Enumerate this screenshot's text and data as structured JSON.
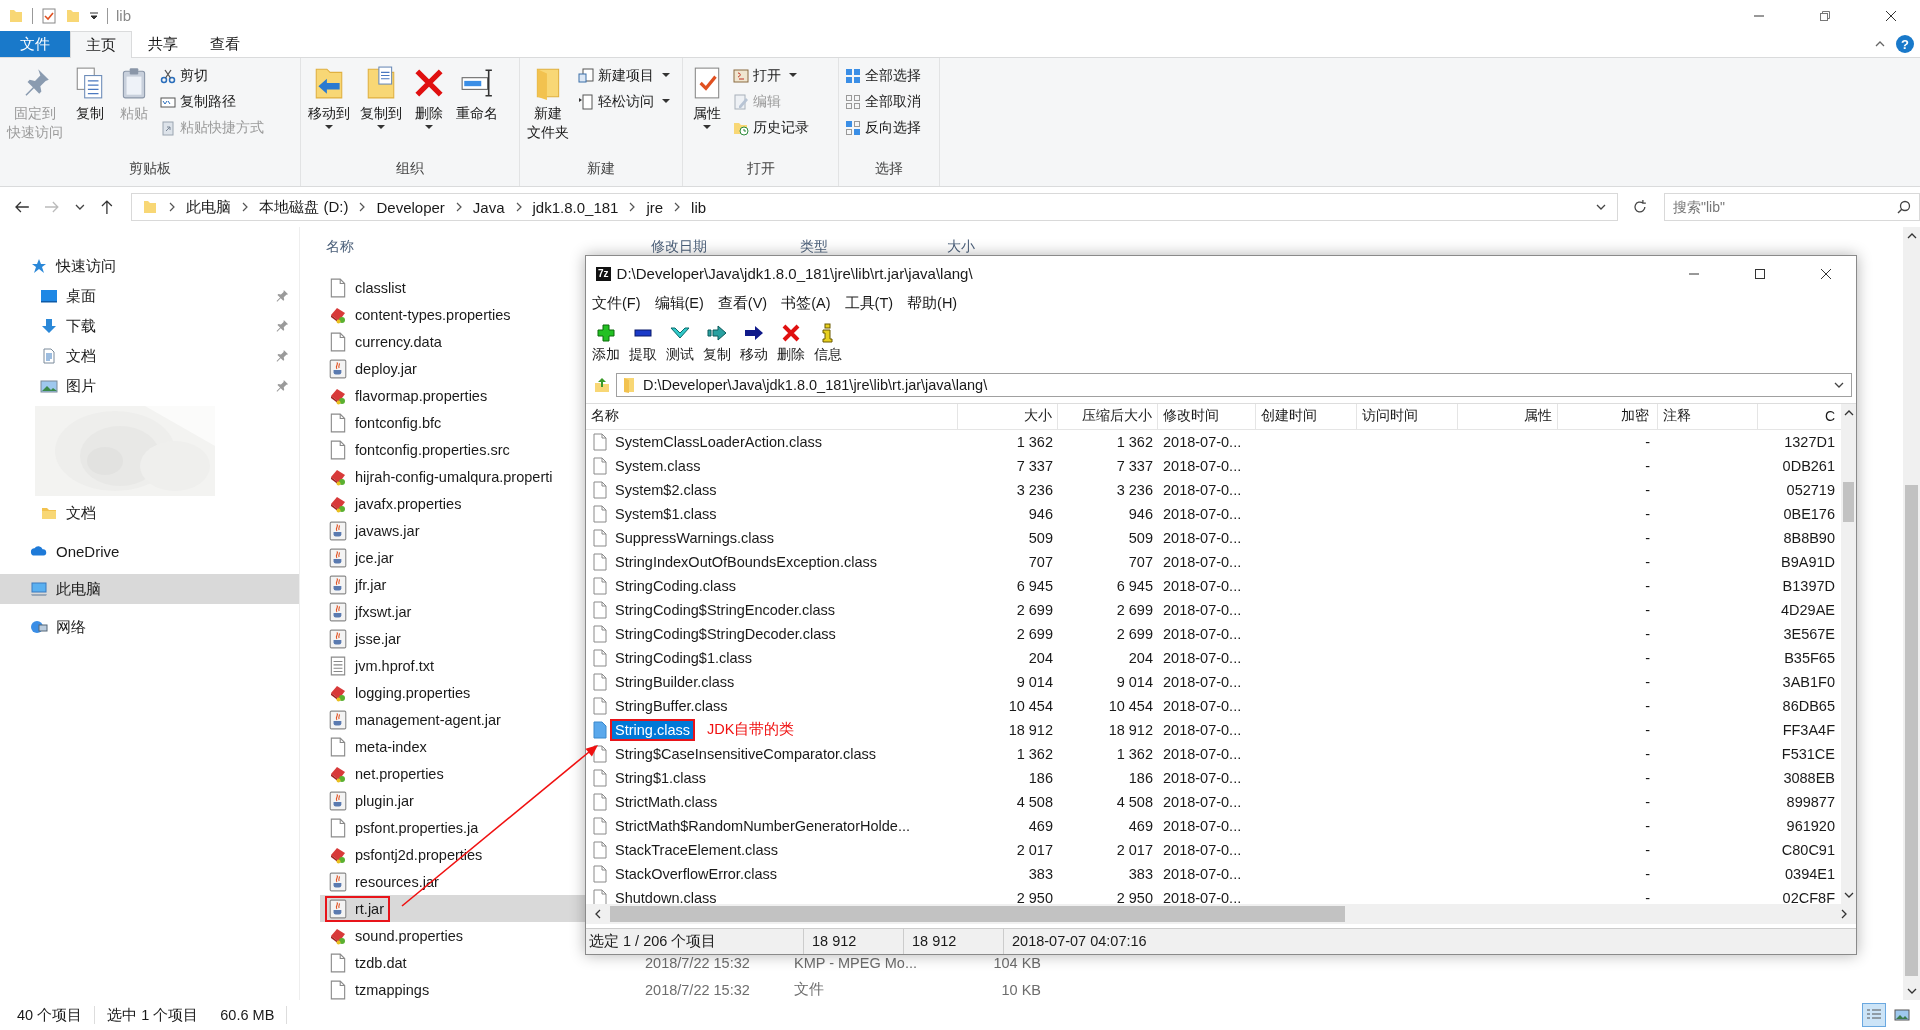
{
  "explorer": {
    "title": "lib",
    "tabs": [
      {
        "label": "文件",
        "kind": "file",
        "selected": false
      },
      {
        "label": "主页",
        "kind": "tab",
        "selected": true
      },
      {
        "label": "共享",
        "kind": "tab",
        "selected": false
      },
      {
        "label": "查看",
        "kind": "tab",
        "selected": false
      }
    ],
    "help": "?",
    "ribbon": [
      {
        "label": "剪贴板",
        "items": [
          {
            "lines": [
              "固定到",
              "快速访问"
            ],
            "kind": "large",
            "disabled": true,
            "dropdown": false
          },
          {
            "lines": [
              "复制"
            ],
            "kind": "large",
            "disabled": false,
            "dropdown": false
          },
          {
            "lines": [
              "粘贴"
            ],
            "kind": "large",
            "disabled": true,
            "dropdown": false
          },
          {
            "label": "剪切",
            "kind": "small",
            "disabled": false,
            "dropdown": false
          },
          {
            "label": "复制路径",
            "kind": "small",
            "disabled": false,
            "dropdown": false
          },
          {
            "label": "粘贴快捷方式",
            "kind": "small",
            "disabled": true,
            "dropdown": false
          }
        ]
      },
      {
        "label": "组织",
        "items": [
          {
            "lines": [
              "移动到"
            ],
            "kind": "large",
            "disabled": false,
            "dropdown": true
          },
          {
            "lines": [
              "复制到"
            ],
            "kind": "large",
            "disabled": false,
            "dropdown": true
          },
          {
            "lines": [
              "删除"
            ],
            "kind": "large",
            "disabled": false,
            "dropdown": true
          },
          {
            "lines": [
              "重命名"
            ],
            "kind": "large",
            "disabled": false,
            "dropdown": false
          }
        ]
      },
      {
        "label": "新建",
        "items": [
          {
            "lines": [
              "新建",
              "文件夹"
            ],
            "kind": "large",
            "disabled": false,
            "dropdown": false
          },
          {
            "label": "新建项目",
            "kind": "small",
            "disabled": false,
            "dropdown": true
          },
          {
            "label": "轻松访问",
            "kind": "small",
            "disabled": false,
            "dropdown": true
          }
        ]
      },
      {
        "label": "打开",
        "items": [
          {
            "lines": [
              "属性"
            ],
            "kind": "large",
            "disabled": false,
            "dropdown": true
          },
          {
            "label": "打开",
            "kind": "small",
            "disabled": false,
            "dropdown": true
          },
          {
            "label": "编辑",
            "kind": "small",
            "disabled": true,
            "dropdown": false
          },
          {
            "label": "历史记录",
            "kind": "small",
            "disabled": false,
            "dropdown": false
          }
        ]
      },
      {
        "label": "选择",
        "items": [
          {
            "label": "全部选择",
            "kind": "small",
            "disabled": false,
            "dropdown": false
          },
          {
            "label": "全部取消",
            "kind": "small",
            "disabled": false,
            "dropdown": false
          },
          {
            "label": "反向选择",
            "kind": "small",
            "disabled": false,
            "dropdown": false
          }
        ]
      }
    ],
    "breadcrumb": [
      "此电脑",
      "本地磁盘 (D:)",
      "Developer",
      "Java",
      "jdk1.8.0_181",
      "jre",
      "lib"
    ],
    "search": {
      "placeholder": "搜索\"lib\""
    },
    "nav": [
      {
        "label": "快速访问",
        "kind": "quick",
        "selected": false,
        "pinned": false,
        "children": [
          {
            "label": "桌面",
            "kind": "desktop",
            "selected": false,
            "pinned": true
          },
          {
            "label": "下载",
            "kind": "download",
            "selected": false,
            "pinned": true
          },
          {
            "label": "文档",
            "kind": "docs",
            "selected": false,
            "pinned": true
          },
          {
            "label": "图片",
            "kind": "pictures",
            "selected": false,
            "pinned": true
          },
          {
            "kind": "picture"
          },
          {
            "label": "文档",
            "kind": "folder",
            "selected": false,
            "pinned": false
          }
        ]
      },
      {
        "label": "OneDrive",
        "kind": "onedrive",
        "selected": false,
        "pinned": false
      },
      {
        "label": "此电脑",
        "kind": "pc",
        "selected": true,
        "pinned": false
      },
      {
        "label": "网络",
        "kind": "network",
        "selected": false,
        "pinned": false
      }
    ],
    "columns": [
      "名称",
      "修改日期",
      "类型",
      "大小"
    ],
    "files": [
      {
        "name": "classlist",
        "kind": "blank",
        "selected": false,
        "annotated": false
      },
      {
        "name": "content-types.properties",
        "kind": "props",
        "selected": false,
        "annotated": false
      },
      {
        "name": "currency.data",
        "kind": "blank",
        "selected": false,
        "annotated": false
      },
      {
        "name": "deploy.jar",
        "kind": "jar",
        "selected": false,
        "annotated": false
      },
      {
        "name": "flavormap.properties",
        "kind": "props",
        "selected": false,
        "annotated": false
      },
      {
        "name": "fontconfig.bfc",
        "kind": "blank",
        "selected": false,
        "annotated": false
      },
      {
        "name": "fontconfig.properties.src",
        "kind": "blank",
        "selected": false,
        "annotated": false
      },
      {
        "name": "hijrah-config-umalqura.properti",
        "kind": "props",
        "selected": false,
        "annotated": false
      },
      {
        "name": "javafx.properties",
        "kind": "props",
        "selected": false,
        "annotated": false
      },
      {
        "name": "javaws.jar",
        "kind": "jar",
        "selected": false,
        "annotated": false
      },
      {
        "name": "jce.jar",
        "kind": "jar",
        "selected": false,
        "annotated": false
      },
      {
        "name": "jfr.jar",
        "kind": "jar",
        "selected": false,
        "annotated": false
      },
      {
        "name": "jfxswt.jar",
        "kind": "jar",
        "selected": false,
        "annotated": false
      },
      {
        "name": "jsse.jar",
        "kind": "jar",
        "selected": false,
        "annotated": false
      },
      {
        "name": "jvm.hprof.txt",
        "kind": "text",
        "selected": false,
        "annotated": false
      },
      {
        "name": "logging.properties",
        "kind": "props",
        "selected": false,
        "annotated": false
      },
      {
        "name": "management-agent.jar",
        "kind": "jar",
        "selected": false,
        "annotated": false
      },
      {
        "name": "meta-index",
        "kind": "blank",
        "selected": false,
        "annotated": false
      },
      {
        "name": "net.properties",
        "kind": "props",
        "selected": false,
        "annotated": false
      },
      {
        "name": "plugin.jar",
        "kind": "jar",
        "selected": false,
        "annotated": false
      },
      {
        "name": "psfont.properties.ja",
        "kind": "blank",
        "selected": false,
        "annotated": false
      },
      {
        "name": "psfontj2d.properties",
        "kind": "props",
        "selected": false,
        "annotated": false
      },
      {
        "name": "resources.jar",
        "kind": "jar",
        "selected": false,
        "annotated": false
      },
      {
        "name": "rt.jar",
        "kind": "jar",
        "selected": true,
        "annotated": true
      },
      {
        "name": "sound.properties",
        "kind": "props",
        "selected": false,
        "annotated": false
      },
      {
        "name": "tzdb.dat",
        "kind": "blank",
        "selected": false,
        "annotated": false,
        "date": "2018/7/22 15:32",
        "type": "KMP - MPEG Mo...",
        "size": "104 KB"
      },
      {
        "name": "tzmappings",
        "kind": "blank",
        "selected": false,
        "annotated": false,
        "date": "2018/7/22 15:32",
        "type": "文件",
        "size": "10 KB"
      }
    ],
    "status": [
      "40 个项目",
      "选中 1 个项目",
      "60.6 MB"
    ],
    "views": [
      {
        "kind": "details",
        "selected": true
      },
      {
        "kind": "icons",
        "selected": false
      }
    ]
  },
  "archive_window": {
    "logo": "7z",
    "title": "D:\\Developer\\Java\\jdk1.8.0_181\\jre\\lib\\rt.jar\\java\\lang\\",
    "menu": [
      "文件(F)",
      "编辑(E)",
      "查看(V)",
      "书签(A)",
      "工具(T)",
      "帮助(H)"
    ],
    "toolbar": [
      {
        "label": "添加",
        "kind": "add"
      },
      {
        "label": "提取",
        "kind": "extract"
      },
      {
        "label": "测试",
        "kind": "test"
      },
      {
        "label": "复制",
        "kind": "copy"
      },
      {
        "label": "移动",
        "kind": "move"
      },
      {
        "label": "删除",
        "kind": "delete"
      },
      {
        "label": "信息",
        "kind": "info"
      }
    ],
    "path": "D:\\Developer\\Java\\jdk1.8.0_181\\jre\\lib\\rt.jar\\java\\lang\\",
    "columns": [
      "名称",
      "大小",
      "压缩后大小",
      "修改时间",
      "创建时间",
      "访问时间",
      "属性",
      "加密",
      "注释",
      "C"
    ],
    "rows": [
      {
        "name": "SystemClassLoaderAction.class",
        "size": "1 362",
        "packed": "1 362",
        "modified": "2018-07-0...",
        "encrypted": "-",
        "crc": "1327D1",
        "selected": false,
        "annotated": false
      },
      {
        "name": "System.class",
        "size": "7 337",
        "packed": "7 337",
        "modified": "2018-07-0...",
        "encrypted": "-",
        "crc": "0DB261",
        "selected": false,
        "annotated": false
      },
      {
        "name": "System$2.class",
        "size": "3 236",
        "packed": "3 236",
        "modified": "2018-07-0...",
        "encrypted": "-",
        "crc": "052719",
        "selected": false,
        "annotated": false
      },
      {
        "name": "System$1.class",
        "size": "946",
        "packed": "946",
        "modified": "2018-07-0...",
        "encrypted": "-",
        "crc": "0BE176",
        "selected": false,
        "annotated": false
      },
      {
        "name": "SuppressWarnings.class",
        "size": "509",
        "packed": "509",
        "modified": "2018-07-0...",
        "encrypted": "-",
        "crc": "8B8B90",
        "selected": false,
        "annotated": false
      },
      {
        "name": "StringIndexOutOfBoundsException.class",
        "size": "707",
        "packed": "707",
        "modified": "2018-07-0...",
        "encrypted": "-",
        "crc": "B9A91D",
        "selected": false,
        "annotated": false
      },
      {
        "name": "StringCoding.class",
        "size": "6 945",
        "packed": "6 945",
        "modified": "2018-07-0...",
        "encrypted": "-",
        "crc": "B1397D",
        "selected": false,
        "annotated": false
      },
      {
        "name": "StringCoding$StringEncoder.class",
        "size": "2 699",
        "packed": "2 699",
        "modified": "2018-07-0...",
        "encrypted": "-",
        "crc": "4D29AE",
        "selected": false,
        "annotated": false
      },
      {
        "name": "StringCoding$StringDecoder.class",
        "size": "2 699",
        "packed": "2 699",
        "modified": "2018-07-0...",
        "encrypted": "-",
        "crc": "3E567E",
        "selected": false,
        "annotated": false
      },
      {
        "name": "StringCoding$1.class",
        "size": "204",
        "packed": "204",
        "modified": "2018-07-0...",
        "encrypted": "-",
        "crc": "B35F65",
        "selected": false,
        "annotated": false
      },
      {
        "name": "StringBuilder.class",
        "size": "9 014",
        "packed": "9 014",
        "modified": "2018-07-0...",
        "encrypted": "-",
        "crc": "3AB1F0",
        "selected": false,
        "annotated": false
      },
      {
        "name": "StringBuffer.class",
        "size": "10 454",
        "packed": "10 454",
        "modified": "2018-07-0...",
        "encrypted": "-",
        "crc": "86DB65",
        "selected": false,
        "annotated": false
      },
      {
        "name": "String.class",
        "size": "18 912",
        "packed": "18 912",
        "modified": "2018-07-0...",
        "encrypted": "-",
        "crc": "FF3A4F",
        "selected": true,
        "annotated": true,
        "note": "JDK自带的类"
      },
      {
        "name": "String$CaseInsensitiveComparator.class",
        "size": "1 362",
        "packed": "1 362",
        "modified": "2018-07-0...",
        "encrypted": "-",
        "crc": "F531CE",
        "selected": false,
        "annotated": false
      },
      {
        "name": "String$1.class",
        "size": "186",
        "packed": "186",
        "modified": "2018-07-0...",
        "encrypted": "-",
        "crc": "3088EB",
        "selected": false,
        "annotated": false
      },
      {
        "name": "StrictMath.class",
        "size": "4 508",
        "packed": "4 508",
        "modified": "2018-07-0...",
        "encrypted": "-",
        "crc": "899877",
        "selected": false,
        "annotated": false
      },
      {
        "name": "StrictMath$RandomNumberGeneratorHolde...",
        "size": "469",
        "packed": "469",
        "modified": "2018-07-0...",
        "encrypted": "-",
        "crc": "961920",
        "selected": false,
        "annotated": false
      },
      {
        "name": "StackTraceElement.class",
        "size": "2 017",
        "packed": "2 017",
        "modified": "2018-07-0...",
        "encrypted": "-",
        "crc": "C80C91",
        "selected": false,
        "annotated": false
      },
      {
        "name": "StackOverflowError.class",
        "size": "383",
        "packed": "383",
        "modified": "2018-07-0...",
        "encrypted": "-",
        "crc": "0394E1",
        "selected": false,
        "annotated": false
      },
      {
        "name": "Shutdown.class",
        "size": "2 950",
        "packed": "2 950",
        "modified": "2018-07-0...",
        "encrypted": "-",
        "crc": "02CF8F",
        "selected": false,
        "annotated": false
      }
    ],
    "status": [
      "选定 1 / 206 个项目",
      "18 912",
      "18 912",
      "2018-07-07 04:07:16"
    ]
  },
  "annotation_arrow": {
    "visible": true
  }
}
